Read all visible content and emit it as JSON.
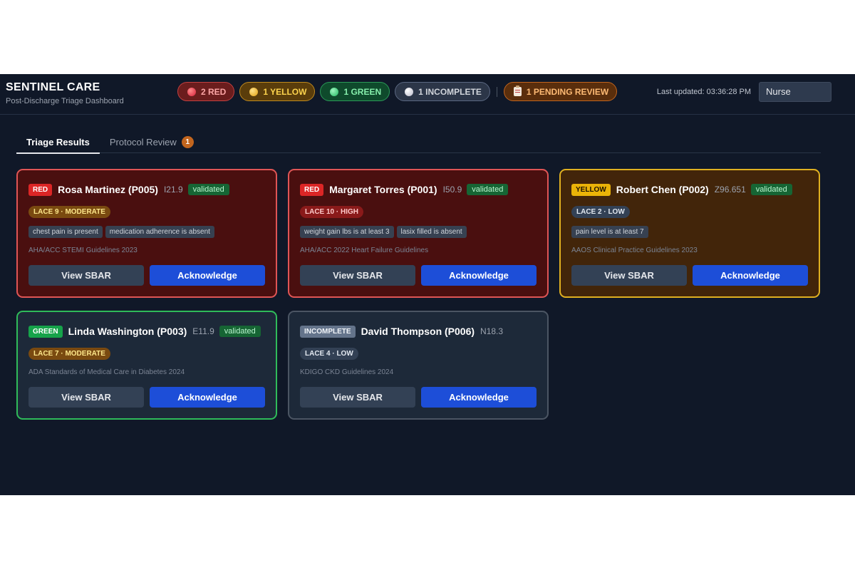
{
  "header": {
    "title": "SENTINEL CARE",
    "subtitle": "Post-Discharge Triage Dashboard",
    "last_updated": "Last updated: 03:36:28 PM",
    "role": "Nurse"
  },
  "summary": {
    "red": "2 RED",
    "yellow": "1 YELLOW",
    "green": "1 GREEN",
    "incomplete": "1 INCOMPLETE",
    "pending": "1 PENDING REVIEW"
  },
  "tabs": [
    {
      "label": "Triage Results"
    },
    {
      "label": "Protocol Review",
      "badge": "1"
    }
  ],
  "buttons": {
    "sbar": "View SBAR",
    "ack": "Acknowledge"
  },
  "cards": [
    {
      "triage": "RED",
      "name": "Rosa Martinez (P005)",
      "code": "I21.9",
      "status": "validated",
      "lace": "LACE 9 · MODERATE",
      "flags": [
        "chest pain is present",
        "medication adherence is absent"
      ],
      "guideline": "AHA/ACC STEMI Guidelines 2023"
    },
    {
      "triage": "RED",
      "name": "Margaret Torres (P001)",
      "code": "I50.9",
      "status": "validated",
      "lace": "LACE 10 · HIGH",
      "flags": [
        "weight gain lbs is at least 3",
        "lasix filled is absent"
      ],
      "guideline": "AHA/ACC 2022 Heart Failure Guidelines"
    },
    {
      "triage": "YELLOW",
      "name": "Robert Chen (P002)",
      "code": "Z96.651",
      "status": "validated",
      "lace": "LACE 2 · LOW",
      "flags": [
        "pain level is at least 7"
      ],
      "guideline": "AAOS Clinical Practice Guidelines 2023"
    },
    {
      "triage": "GREEN",
      "name": "Linda Washington (P003)",
      "code": "E11.9",
      "status": "validated",
      "lace": "LACE 7 · MODERATE",
      "guideline": "ADA Standards of Medical Care in Diabetes 2024"
    },
    {
      "triage": "INCOMPLETE",
      "name": "David Thompson (P006)",
      "code": "N18.3",
      "lace": "LACE 4 · LOW",
      "guideline": "KDIGO CKD Guidelines 2024"
    }
  ]
}
